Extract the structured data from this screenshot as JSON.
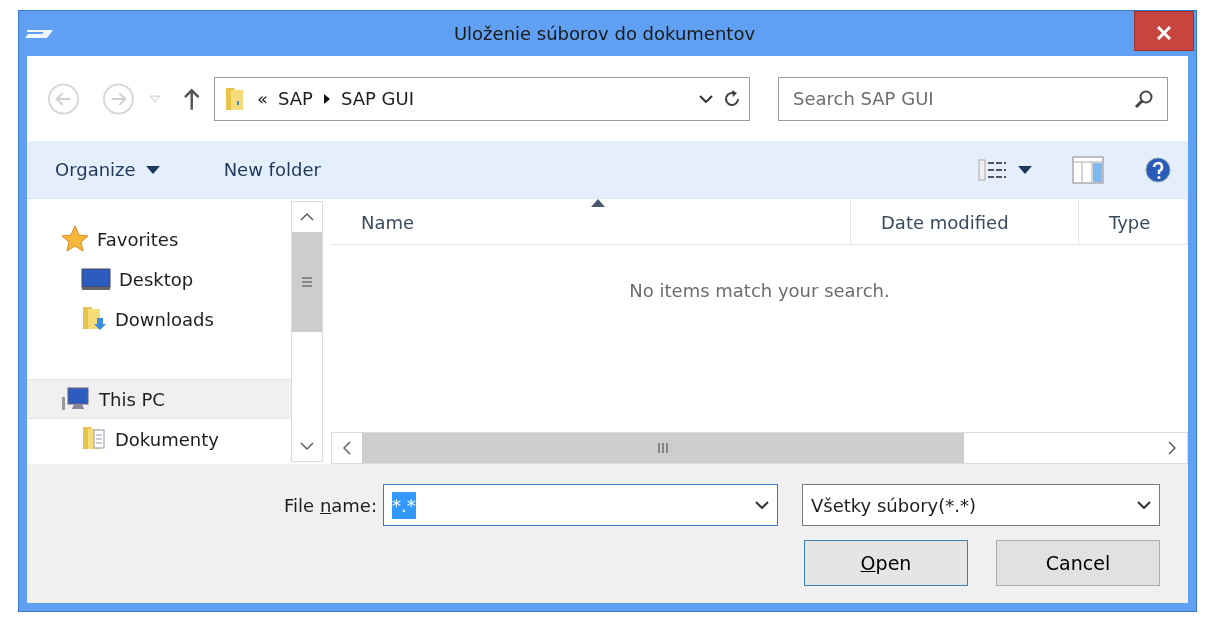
{
  "window": {
    "title": "Uloženie súborov do dokumentov"
  },
  "address_bar": {
    "overflow": "«",
    "path": [
      "SAP",
      "SAP GUI"
    ]
  },
  "search": {
    "placeholder": "Search SAP GUI"
  },
  "toolbar": {
    "buttons": [
      {
        "label": "Organize",
        "dropdown": true
      },
      {
        "label": "New folder",
        "dropdown": false
      }
    ]
  },
  "navigation": {
    "items": [
      {
        "label": "Favorites",
        "kind": "star",
        "selected": false,
        "children": [
          {
            "label": "Desktop",
            "kind": "desktop",
            "selected": false
          },
          {
            "label": "Downloads",
            "kind": "downloads",
            "selected": false
          }
        ]
      },
      {
        "label": "This PC",
        "kind": "pc",
        "selected": true,
        "children": [
          {
            "label": "Dokumenty",
            "kind": "documents",
            "selected": false
          }
        ]
      }
    ]
  },
  "file_list": {
    "columns": [
      {
        "label": "Name",
        "sorted": true
      },
      {
        "label": "Date modified",
        "sorted": false
      },
      {
        "label": "Type",
        "sorted": false
      }
    ],
    "empty_message": "No items match your search."
  },
  "file_name": {
    "label_parts": [
      {
        "text": "File ",
        "underline": false
      },
      {
        "text": "n",
        "underline": true
      },
      {
        "text": "ame:",
        "underline": false
      }
    ],
    "value": "*.*",
    "text_selected": true
  },
  "file_type": {
    "value": "Všetky súbory(*.*)"
  },
  "buttons": [
    {
      "label_parts": [
        {
          "text": "O",
          "underline": true
        },
        {
          "text": "pen",
          "underline": false
        }
      ],
      "default": true
    },
    {
      "label_parts": [
        {
          "text": "Cancel",
          "underline": false
        }
      ],
      "default": false
    }
  ]
}
